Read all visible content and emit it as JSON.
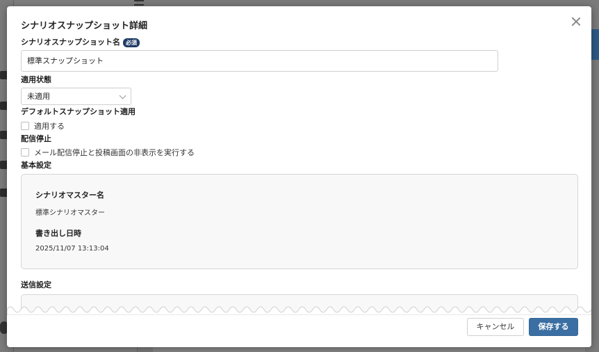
{
  "modal": {
    "title": "シナリオスナップショット詳細",
    "close_icon": "close-icon"
  },
  "form": {
    "name_label": "シナリオスナップショット名",
    "required_badge": "必須",
    "name_value": "標準スナップショット",
    "status_label": "適用状態",
    "status_value": "未適用",
    "default_label": "デフォルトスナップショット適用",
    "default_checkbox_label": "適用する",
    "default_checked": false,
    "stop_label": "配信停止",
    "stop_checkbox_label": "メール配信停止と投稿画面の非表示を実行する",
    "stop_checked": false
  },
  "basic_settings": {
    "section_label": "基本設定",
    "master_name_label": "シナリオマスター名",
    "master_name_value": "標準シナリオマスター",
    "export_datetime_label": "書き出し日時",
    "export_datetime_value": "2025/11/07 13:13:04"
  },
  "send_settings": {
    "section_label": "送信設定"
  },
  "footer": {
    "cancel_label": "キャンセル",
    "save_label": "保存する"
  },
  "colors": {
    "accent": "#3b6fa3",
    "badge": "#1f3a66"
  }
}
